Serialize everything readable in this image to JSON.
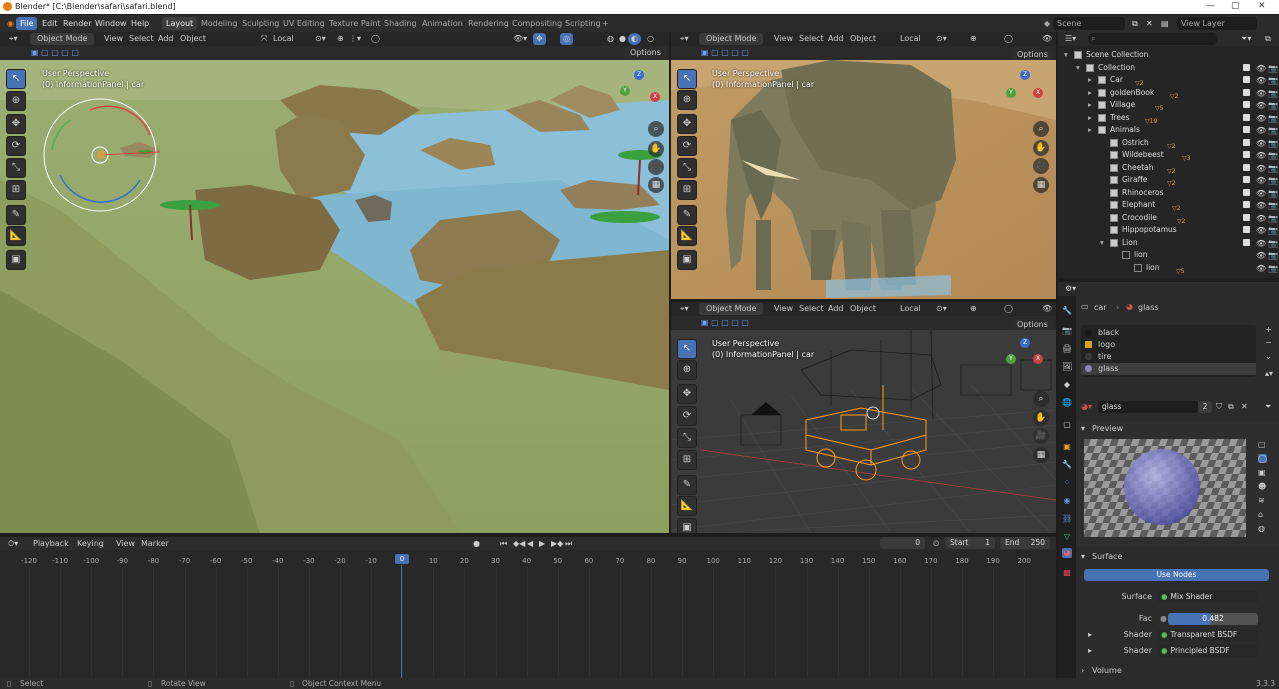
{
  "window": {
    "title": "Blender* [C:\\Blender\\safari\\safari.blend]"
  },
  "menus": [
    "File",
    "Edit",
    "Render",
    "Window",
    "Help"
  ],
  "workspaces": [
    "Layout",
    "Modeling",
    "Sculpting",
    "UV Editing",
    "Texture Paint",
    "Shading",
    "Animation",
    "Rendering",
    "Compositing",
    "Scripting"
  ],
  "scene": {
    "name": "Scene",
    "view_layer": "View Layer"
  },
  "viewport_header": {
    "mode": "Object Mode",
    "menus": [
      "View",
      "Select",
      "Add",
      "Object"
    ],
    "orientation": "Local",
    "options": "Options"
  },
  "viewports": [
    {
      "title": "User Perspective",
      "subtitle": "(0) InformationPanel | car"
    },
    {
      "title": "User Perspective",
      "subtitle": "(0) InformationPanel | car"
    },
    {
      "title": "User Perspective",
      "subtitle": "(0) InformationPanel | car"
    }
  ],
  "gizmo": {
    "x": "X",
    "y": "Y",
    "z": "Z"
  },
  "outliner": {
    "rows": [
      {
        "label": "Scene Collection",
        "indent": 0,
        "num": ""
      },
      {
        "label": "Collection",
        "indent": 1,
        "num": ""
      },
      {
        "label": "Car",
        "indent": 2,
        "num": "2"
      },
      {
        "label": "goldenBook",
        "indent": 2,
        "num": "2"
      },
      {
        "label": "Village",
        "indent": 2,
        "num": "5"
      },
      {
        "label": "Trees",
        "indent": 2,
        "num": "19"
      },
      {
        "label": "Animals",
        "indent": 2,
        "num": ""
      },
      {
        "label": "Ostrich",
        "indent": 3,
        "num": "2"
      },
      {
        "label": "Wildebeest",
        "indent": 3,
        "num": "3"
      },
      {
        "label": "Cheetah",
        "indent": 3,
        "num": "2"
      },
      {
        "label": "Giraffe",
        "indent": 3,
        "num": "2"
      },
      {
        "label": "Rhinoceros",
        "indent": 3,
        "num": ""
      },
      {
        "label": "Elephant",
        "indent": 3,
        "num": "2"
      },
      {
        "label": "Crocodile",
        "indent": 3,
        "num": "2"
      },
      {
        "label": "Hippopotamus",
        "indent": 3,
        "num": ""
      },
      {
        "label": "Lion",
        "indent": 3,
        "num": ""
      },
      {
        "label": "lion",
        "indent": 4,
        "num": ""
      },
      {
        "label": "lion",
        "indent": 5,
        "num": "5"
      }
    ]
  },
  "properties": {
    "breadcrumb": {
      "object": "car",
      "material": "glass"
    },
    "slots": [
      "black",
      "logo",
      "tire",
      "glass"
    ],
    "slot_colors": [
      "#1a1a1a",
      "#d8a020",
      "#3a3a3a",
      "#8888aa"
    ],
    "material_name": "glass",
    "users": "2",
    "preview_label": "Preview",
    "surface_label": "Surface",
    "use_nodes": "Use Nodes",
    "fields": [
      {
        "label": "Surface",
        "value": "Mix Shader"
      },
      {
        "label": "Fac",
        "value": "0.482"
      },
      {
        "label": "Shader",
        "value": "Transparent BSDF"
      },
      {
        "label": "Shader",
        "value": "Principled BSDF"
      }
    ],
    "fac_fraction": 0.482,
    "volume_label": "Volume"
  },
  "timeline": {
    "menus": [
      "Playback",
      "Keying",
      "View",
      "Marker"
    ],
    "current_frame": "0",
    "start_label": "Start",
    "start": "1",
    "end_label": "End",
    "end": "250",
    "ticks": [
      "-120",
      "-110",
      "-100",
      "-90",
      "-80",
      "-70",
      "-60",
      "-50",
      "-40",
      "-30",
      "-20",
      "-10",
      "0",
      "10",
      "20",
      "30",
      "40",
      "50",
      "60",
      "70",
      "80",
      "90",
      "100",
      "110",
      "120",
      "130",
      "140",
      "150",
      "160",
      "170",
      "180",
      "190",
      "200"
    ],
    "playhead": "0"
  },
  "status": {
    "select": "Select",
    "rotate": "Rotate View",
    "context": "Object Context Menu",
    "version": "3.3.3"
  }
}
